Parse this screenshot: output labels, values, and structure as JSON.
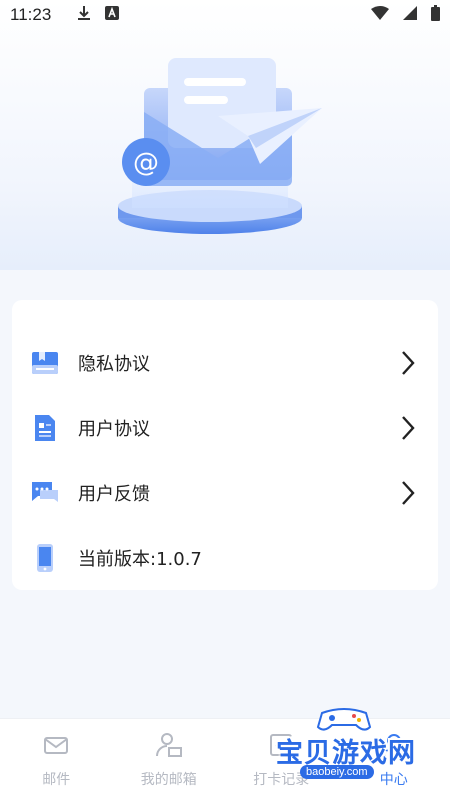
{
  "status_bar": {
    "time": "11:23",
    "icons": [
      "download-icon",
      "keyboard-a-icon",
      "wifi-icon",
      "cell-signal-icon",
      "battery-icon"
    ]
  },
  "hero": {
    "illustration": "email-envelope-illustration"
  },
  "menu": {
    "items": [
      {
        "label": "隐私协议",
        "icon": "privacy-book-icon",
        "has_arrow": true
      },
      {
        "label": "用户协议",
        "icon": "document-icon",
        "has_arrow": true
      },
      {
        "label": "用户反馈",
        "icon": "chat-feedback-icon",
        "has_arrow": true
      },
      {
        "label": "当前版本:1.0.7",
        "icon": "phone-icon",
        "has_arrow": false
      }
    ]
  },
  "tab_bar": {
    "tabs": [
      {
        "label": "邮件",
        "icon": "mail-icon",
        "active": false
      },
      {
        "label": "我的邮箱",
        "icon": "user-mail-icon",
        "active": false
      },
      {
        "label": "打卡记录",
        "icon": "checkin-icon",
        "active": false
      },
      {
        "label": "中心",
        "icon": "center-icon",
        "active": true
      }
    ]
  },
  "watermark": {
    "text": "宝贝游戏网",
    "url": "baobeiy.com"
  },
  "colors": {
    "accent": "#3a7bf0",
    "icon_blue": "#4a86f0",
    "inactive": "#b5b9c2"
  }
}
